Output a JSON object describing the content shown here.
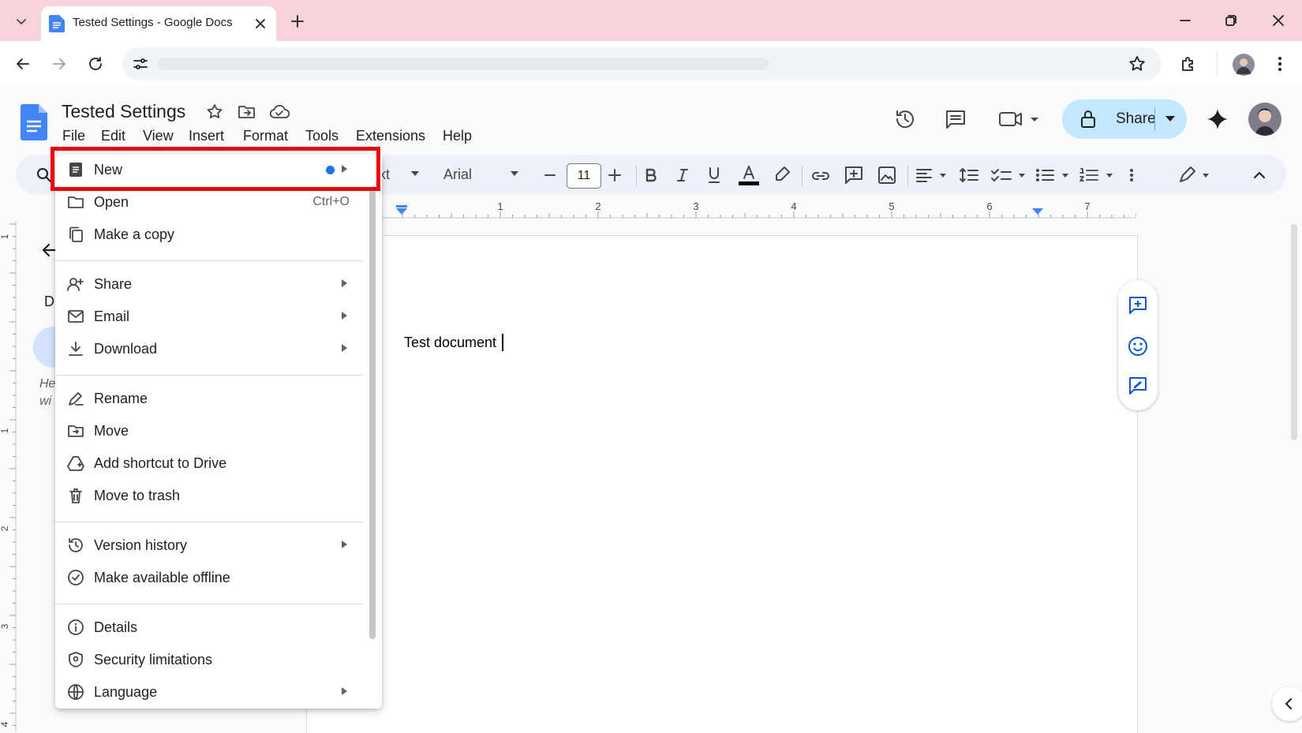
{
  "browser": {
    "tab_title": "Tested Settings - Google Docs",
    "icons": [
      "tab-search-icon",
      "docs-favicon-icon",
      "close-icon",
      "new-tab-icon",
      "minimize-icon",
      "restore-icon",
      "window-close-icon",
      "back-icon",
      "forward-icon",
      "reload-icon",
      "site-settings-icon",
      "bookmark-star-icon",
      "extensions-icon",
      "profile-avatar",
      "more-icon"
    ]
  },
  "doc": {
    "title": "Tested Settings",
    "menu_bar": [
      "File",
      "Edit",
      "View",
      "Insert",
      "Format",
      "Tools",
      "Extensions",
      "Help"
    ],
    "share_label": "Share",
    "body_text": "Test document"
  },
  "toolbar": {
    "style_fragment": "xt",
    "font_name": "Arial",
    "font_size": "11"
  },
  "ruler": {
    "h_numbers": [
      "1",
      "2",
      "3",
      "4",
      "5",
      "6",
      "7"
    ],
    "v_numbers": [
      "1",
      "1",
      "2",
      "3",
      "4"
    ]
  },
  "left_panel": {
    "letter": "D",
    "hint_line1": "He",
    "hint_line2": "wi"
  },
  "file_menu": {
    "new": {
      "label": "New"
    },
    "open": {
      "label": "Open",
      "shortcut": "Ctrl+O"
    },
    "make_copy": {
      "label": "Make a copy"
    },
    "share": {
      "label": "Share"
    },
    "email": {
      "label": "Email"
    },
    "download": {
      "label": "Download"
    },
    "rename": {
      "label": "Rename"
    },
    "move": {
      "label": "Move"
    },
    "add_shortcut": {
      "label": "Add shortcut to Drive"
    },
    "trash": {
      "label": "Move to trash"
    },
    "version_history": {
      "label": "Version history"
    },
    "offline": {
      "label": "Make available offline"
    },
    "details": {
      "label": "Details"
    },
    "security": {
      "label": "Security limitations"
    },
    "language": {
      "label": "Language"
    }
  },
  "colors": {
    "tab_strip": "#f9d3dc",
    "share_button": "#c2e7ff",
    "highlight_box": "#ee0000",
    "docs_blue": "#4285f4",
    "new_dot": "#1a73e8"
  }
}
